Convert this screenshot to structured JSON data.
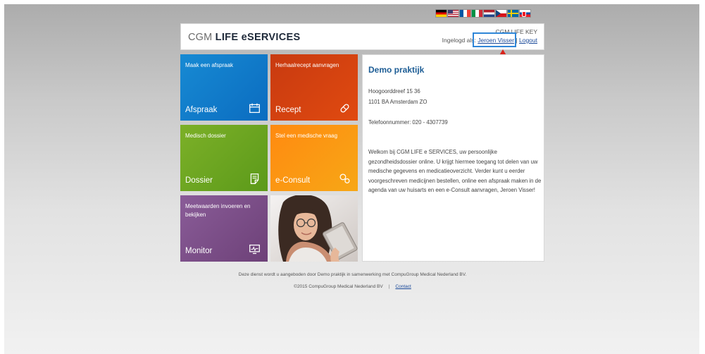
{
  "languages": [
    {
      "code": "de",
      "icon": "flag-germany"
    },
    {
      "code": "en",
      "icon": "flag-usa"
    },
    {
      "code": "fr",
      "icon": "flag-france"
    },
    {
      "code": "it",
      "icon": "flag-italy"
    },
    {
      "code": "nl",
      "icon": "flag-netherlands"
    },
    {
      "code": "cz",
      "icon": "flag-czech-republic"
    },
    {
      "code": "se",
      "icon": "flag-sweden"
    },
    {
      "code": "sk",
      "icon": "flag-slovakia"
    }
  ],
  "header": {
    "logo_prefix": "CGM ",
    "logo_brand": "LIFE eSERVICES",
    "product_name": "CGM LIFE KEY",
    "login_prefix": "Ingelogd als: ",
    "user_name": "Jeroen Visser",
    "separator": " | ",
    "logout_label": "Logout"
  },
  "tiles": [
    {
      "id": "afspraak",
      "subtitle": "Maak een afspraak",
      "title": "Afspraak",
      "icon": "calendar-icon",
      "color": "#1080d0"
    },
    {
      "id": "recept",
      "subtitle": "Herhaalrecept aanvragen",
      "title": "Recept",
      "icon": "pill-icon",
      "color": "#d8410f"
    },
    {
      "id": "dossier",
      "subtitle": "Medisch dossier",
      "title": "Dossier",
      "icon": "document-icon",
      "color": "#6ea620"
    },
    {
      "id": "consult",
      "subtitle": "Stel een medische vraag",
      "title": "e-Consult",
      "icon": "chat-icon",
      "color": "#fa9512"
    },
    {
      "id": "monitor",
      "subtitle": "Meetwaarden invoeren en bekijken",
      "title": "Monitor",
      "icon": "monitor-icon",
      "color": "#7a4c88"
    }
  ],
  "practice": {
    "name": "Demo praktijk",
    "address_line1": "Hoogoorddreef 15 36",
    "address_line2": "1101 BA Amsterdam ZO",
    "phone": "Telefoonnummer: 020 - 4307739",
    "welcome": "Welkom bij CGM LIFE e SERVICES, uw persoonlijke gezondheidsdossier online. U krijgt hiermee toegang tot delen van uw medische gegevens en medicatieoverzicht. Verder kunt u eerder voorgeschreven medicijnen bestellen, online een afspraak maken in de agenda van uw huisarts en een e-Consult aanvragen, Jeroen Visser!"
  },
  "footer": {
    "disclaimer": "Deze dienst wordt u aangeboden door Demo praktijk in samenwerking met CompuGroup Medical Nederland BV.",
    "copyright": "©2015 CompuGroup Medical Nederland BV",
    "separator": "|",
    "contact_label": "Contact"
  },
  "colors": {
    "accent_blue": "#1d5d95",
    "link": "#1b4a9a",
    "highlight_box": "#2f86d8",
    "annotation_arrow": "#d9241c"
  }
}
